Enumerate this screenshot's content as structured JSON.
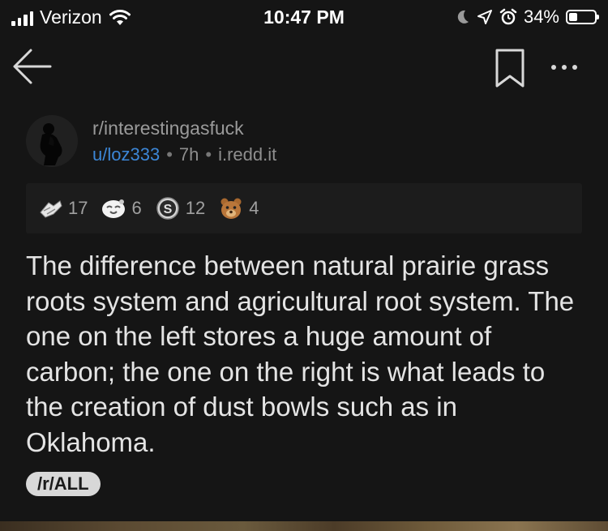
{
  "status_bar": {
    "carrier": "Verizon",
    "time": "10:47 PM",
    "battery_percent": "34%",
    "battery_level": 0.34,
    "icons": [
      "signal-icon",
      "wifi-icon",
      "moon-icon",
      "location-icon",
      "alarm-icon",
      "battery-icon"
    ]
  },
  "nav": {
    "icons": [
      "back-arrow-icon",
      "bookmark-icon",
      "more-icon"
    ]
  },
  "post": {
    "subreddit": "r/interestingasfuck",
    "author": "u/loz333",
    "separator": "•",
    "age": "7h",
    "domain": "i.redd.it",
    "awards": [
      {
        "icon": "helpful-hands-award-icon",
        "count": "17"
      },
      {
        "icon": "wholesome-award-icon",
        "count": "6"
      },
      {
        "icon": "silver-award-icon",
        "count": "12"
      },
      {
        "icon": "bear-award-icon",
        "count": "4"
      }
    ],
    "title": "The difference between natural prairie grass roots system and agricultural root system. The one on the left stores a huge amount of carbon; the one on the right is what leads to the creation of dust bowls such as in Oklahoma.",
    "flair": "/r/ALL"
  },
  "colors": {
    "background": "#151515",
    "author_link": "#3c86d6",
    "flair_bg": "#d8d8d8"
  }
}
